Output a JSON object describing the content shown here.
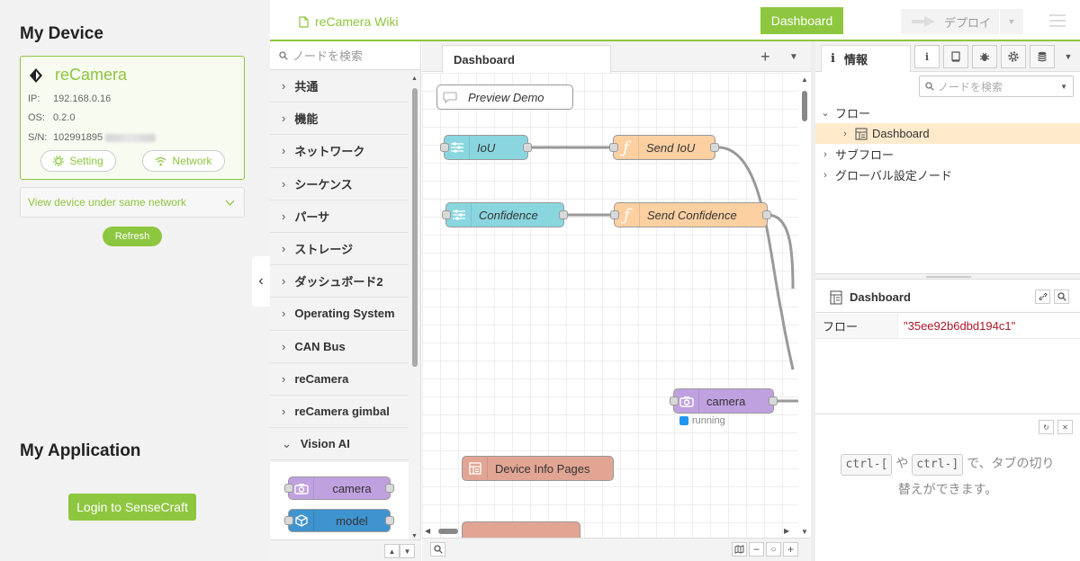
{
  "left": {
    "my_device_title": "My Device",
    "device": {
      "name": "reCamera",
      "ip_label": "IP:",
      "ip": "192.168.0.16",
      "os_label": "OS:",
      "os": "0.2.0",
      "sn_label": "S/N:",
      "sn": "102991895"
    },
    "setting_label": "Setting",
    "network_label": "Network",
    "view_dropdown_label": "View device under same network",
    "refresh_label": "Refresh",
    "my_application_title": "My Application",
    "login_label": "Login to SenseCraft"
  },
  "header": {
    "wiki_label": "reCamera Wiki",
    "dashboard_button": "Dashboard",
    "deploy_label": "デプロイ"
  },
  "palette": {
    "search_placeholder": "ノードを検索",
    "categories": [
      "共通",
      "機能",
      "ネットワーク",
      "シーケンス",
      "パーサ",
      "ストレージ",
      "ダッシュボード2",
      "Operating System",
      "CAN Bus",
      "reCamera",
      "reCamera gimbal",
      "Vision AI"
    ],
    "nodes": [
      {
        "label": "camera",
        "color": "#c0a1e0",
        "icon": "camera-icon"
      },
      {
        "label": "model",
        "color": "#3f93cf",
        "icon": "cube-icon"
      }
    ]
  },
  "workspace": {
    "tab_label": "Dashboard",
    "comment": "Preview Demo",
    "nodes": {
      "iou": "IoU",
      "send_iou": "Send IoU",
      "confidence": "Confidence",
      "send_confidence": "Send Confidence",
      "camera": "camera",
      "camera_status": "running",
      "device_info": "Device Info Pages"
    }
  },
  "sidebar": {
    "tab_label": "情報",
    "search_placeholder": "ノードを検索",
    "tree": {
      "flows": "フロー",
      "dashboard": "Dashboard",
      "subflows": "サブフロー",
      "global_config": "グローバル設定ノード"
    },
    "props_title": "Dashboard",
    "props_key": "フロー",
    "props_value": "\"35ee92b6dbd194c1\"",
    "help": {
      "key1": "ctrl-[",
      "mid": "や",
      "key2": "ctrl-]",
      "suffix": "で、タブの切り替えができます。"
    }
  },
  "colors": {
    "accent": "#8dc63f",
    "node_purple": "#c0a1e0",
    "node_blue": "#3f93cf",
    "node_cyan": "#8ad6df",
    "node_orange": "#fdd0a2",
    "node_salmon": "#e2a593",
    "status_blue": "#2196f3"
  }
}
